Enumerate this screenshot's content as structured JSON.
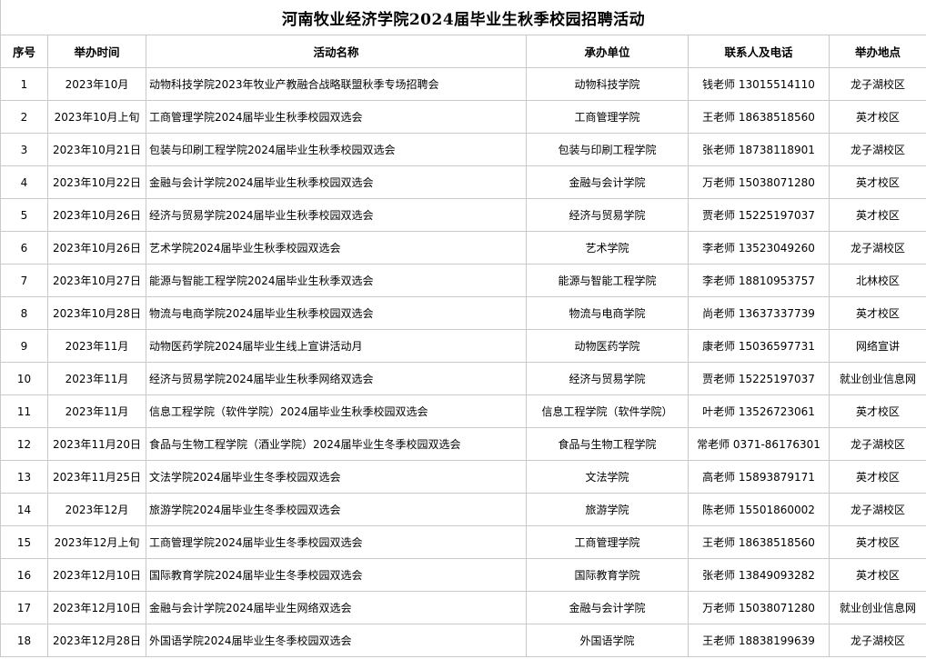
{
  "title": "河南牧业经济学院2024届毕业生秋季校园招聘活动",
  "headers": [
    "序号",
    "举办时间",
    "活动名称",
    "承办单位",
    "联系人及电话",
    "举办地点"
  ],
  "rows": [
    [
      "1",
      "2023年10月",
      "动物科技学院2023年牧业产教融合战略联盟秋季专场招聘会",
      "动物科技学院",
      "钱老师  13015514110",
      "龙子湖校区"
    ],
    [
      "2",
      "2023年10月上旬",
      "工商管理学院2024届毕业生秋季校园双选会",
      "工商管理学院",
      "王老师  18638518560",
      "英才校区"
    ],
    [
      "3",
      "2023年10月21日",
      "包装与印刷工程学院2024届毕业生秋季校园双选会",
      "包装与印刷工程学院",
      "张老师  18738118901",
      "龙子湖校区"
    ],
    [
      "4",
      "2023年10月22日",
      "金融与会计学院2024届毕业生秋季校园双选会",
      "金融与会计学院",
      "万老师  15038071280",
      "英才校区"
    ],
    [
      "5",
      "2023年10月26日",
      "经济与贸易学院2024届毕业生秋季校园双选会",
      "经济与贸易学院",
      "贾老师  15225197037",
      "英才校区"
    ],
    [
      "6",
      "2023年10月26日",
      "艺术学院2024届毕业生秋季校园双选会",
      "艺术学院",
      "李老师  13523049260",
      "龙子湖校区"
    ],
    [
      "7",
      "2023年10月27日",
      "能源与智能工程学院2024届毕业生秋季双选会",
      "能源与智能工程学院",
      "李老师  18810953757",
      "北林校区"
    ],
    [
      "8",
      "2023年10月28日",
      "物流与电商学院2024届毕业生秋季校园双选会",
      "物流与电商学院",
      "尚老师  13637337739",
      "英才校区"
    ],
    [
      "9",
      "2023年11月",
      "动物医药学院2024届毕业生线上宣讲活动月",
      "动物医药学院",
      "康老师  15036597731",
      "网络宣讲"
    ],
    [
      "10",
      "2023年11月",
      "经济与贸易学院2024届毕业生秋季网络双选会",
      "经济与贸易学院",
      "贾老师  15225197037",
      "就业创业信息网"
    ],
    [
      "11",
      "2023年11月",
      "信息工程学院（软件学院）2024届毕业生秋季校园双选会",
      "信息工程学院（软件学院）",
      "叶老师  13526723061",
      "英才校区"
    ],
    [
      "12",
      "2023年11月20日",
      "食品与生物工程学院（酒业学院）2024届毕业生冬季校园双选会",
      "食品与生物工程学院",
      "常老师  0371-86176301",
      "龙子湖校区"
    ],
    [
      "13",
      "2023年11月25日",
      "文法学院2024届毕业生冬季校园双选会",
      "文法学院",
      "高老师  15893879171",
      "英才校区"
    ],
    [
      "14",
      "2023年12月",
      "旅游学院2024届毕业生冬季校园双选会",
      "旅游学院",
      "陈老师  15501860002",
      "龙子湖校区"
    ],
    [
      "15",
      "2023年12月上旬",
      "工商管理学院2024届毕业生冬季校园双选会",
      "工商管理学院",
      "王老师  18638518560",
      "英才校区"
    ],
    [
      "16",
      "2023年12月10日",
      "国际教育学院2024届毕业生冬季校园双选会",
      "国际教育学院",
      "张老师  13849093282",
      "英才校区"
    ],
    [
      "17",
      "2023年12月10日",
      "金融与会计学院2024届毕业生网络双选会",
      "金融与会计学院",
      "万老师  15038071280",
      "就业创业信息网"
    ],
    [
      "18",
      "2023年12月28日",
      "外国语学院2024届毕业生冬季校园双选会",
      "外国语学院",
      "王老师  18838199639",
      "龙子湖校区"
    ]
  ]
}
